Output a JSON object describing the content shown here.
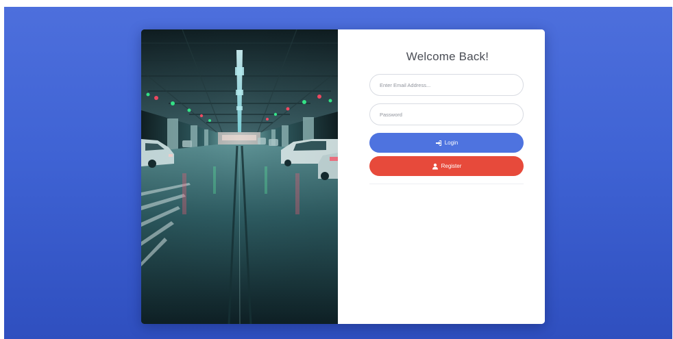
{
  "page": {
    "background_gradient": [
      "#4d6fdc",
      "#2f4fbf"
    ]
  },
  "login_card": {
    "image": {
      "subject": "underground parking garage",
      "icon": "photo"
    },
    "title": "Welcome Back!",
    "email_field": {
      "placeholder": "Enter Email Address...",
      "value": ""
    },
    "password_field": {
      "placeholder": "Password",
      "value": ""
    },
    "login_button": {
      "label": "Login",
      "icon": "sign-in-icon",
      "color": "#4e73df"
    },
    "register_button": {
      "label": "Register",
      "icon": "user-icon",
      "color": "#e74a3b"
    }
  }
}
